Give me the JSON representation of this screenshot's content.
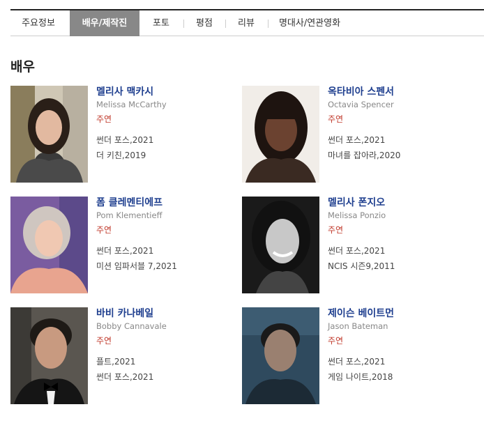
{
  "tabs": [
    {
      "label": "주요정보"
    },
    {
      "label": "배우/제작진"
    },
    {
      "label": "포토"
    },
    {
      "label": "평점"
    },
    {
      "label": "리뷰"
    },
    {
      "label": "명대사/연관영화"
    }
  ],
  "section_title": "배우",
  "actors": [
    {
      "name_ko": "멜리사 맥카시",
      "name_en": "Melissa McCarthy",
      "role": "주연",
      "works": [
        "썬더 포스,2021",
        "더 키친,2019"
      ]
    },
    {
      "name_ko": "옥타비아 스펜서",
      "name_en": "Octavia Spencer",
      "role": "주연",
      "works": [
        "썬더 포스,2021",
        "마녀를 잡아라,2020"
      ]
    },
    {
      "name_ko": "폼 클레멘티에프",
      "name_en": "Pom Klementieff",
      "role": "주연",
      "works": [
        "썬더 포스,2021",
        "미션 임파서블 7,2021"
      ]
    },
    {
      "name_ko": "멜리사 폰지오",
      "name_en": "Melissa Ponzio",
      "role": "주연",
      "works": [
        "썬더 포스,2021",
        "NCIS 시즌9,2011"
      ]
    },
    {
      "name_ko": "바비 카나베일",
      "name_en": "Bobby Cannavale",
      "role": "주연",
      "works": [
        "플트,2021",
        "썬더 포스,2021"
      ]
    },
    {
      "name_ko": "제이슨 베이트먼",
      "name_en": "Jason Bateman",
      "role": "주연",
      "works": [
        "썬더 포스,2021",
        "게임 나이트,2018"
      ]
    }
  ],
  "colors": {
    "name": "#1f3f8f",
    "role": "#c0392b",
    "active_tab": "#888888"
  }
}
